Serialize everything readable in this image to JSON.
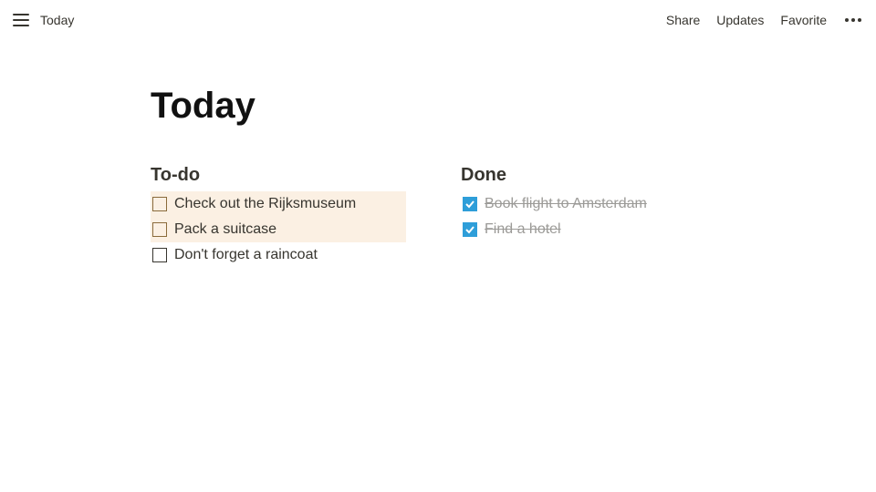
{
  "topbar": {
    "breadcrumb": "Today",
    "actions": {
      "share": "Share",
      "updates": "Updates",
      "favorite": "Favorite"
    }
  },
  "page": {
    "title": "Today"
  },
  "columns": {
    "todo": {
      "heading": "To-do",
      "items": [
        {
          "label": "Check out the Rijksmuseum",
          "checked": false,
          "highlight": true
        },
        {
          "label": "Pack a suitcase",
          "checked": false,
          "highlight": true
        },
        {
          "label": "Don't forget a raincoat",
          "checked": false,
          "highlight": false
        }
      ]
    },
    "done": {
      "heading": "Done",
      "items": [
        {
          "label": "Book flight to Amsterdam",
          "checked": true,
          "highlight": false
        },
        {
          "label": "Find a hotel",
          "checked": true,
          "highlight": false
        }
      ]
    }
  }
}
